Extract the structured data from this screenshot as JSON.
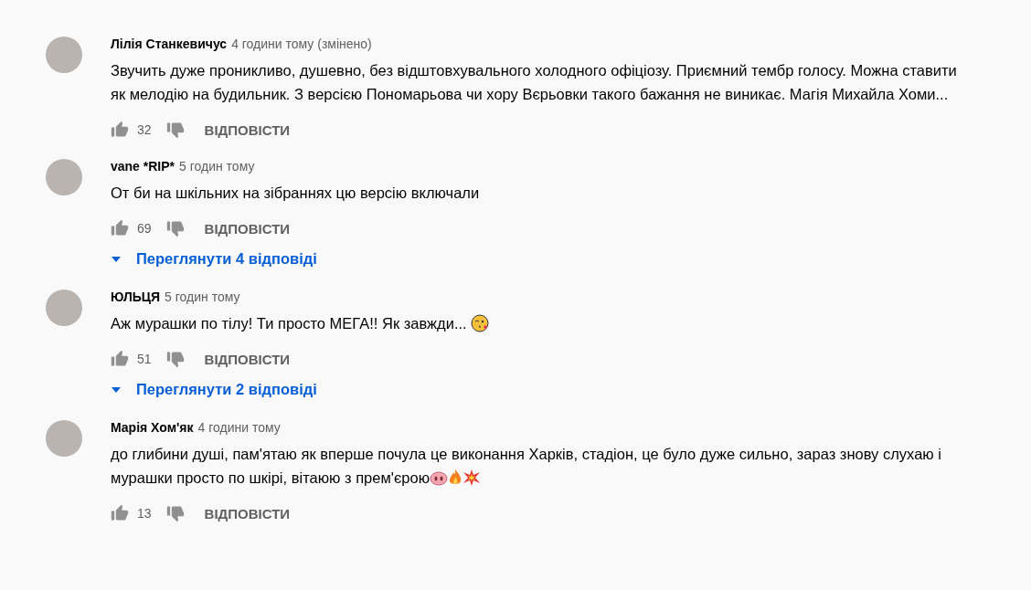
{
  "comments": [
    {
      "author": "Лілія Станкевичус",
      "time": "4 години тому (змінено)",
      "text": "Звучить дуже проникливо, душевно, без відштовхувального холодного офіціозу. Приємний тембр голосу. Можна ставити як мелодію на будильник. З версією Пономарьова чи хору Вєрьовки такого бажання не виникає. Магія Михайла Хоми...",
      "likes": "32",
      "reply": "ВІДПОВІСТИ"
    },
    {
      "author": "vane *RIP*",
      "time": "5 годин тому",
      "text": "От би на шкільних на зібраннях цю версію включали",
      "likes": "69",
      "reply": "ВІДПОВІСТИ",
      "replies": "Переглянути 4 відповіді"
    },
    {
      "author": "ЮЛЬЦЯ",
      "time": "5 годин тому",
      "text": "Аж мурашки по тілу! Ти просто МЕГА!! Як завжди... ",
      "emojis": [
        {
          "kind": "kiss"
        }
      ],
      "likes": "51",
      "reply": "ВІДПОВІСТИ",
      "replies": "Переглянути 2 відповіді"
    },
    {
      "author": "Марія Хом'як",
      "time": "4 години тому",
      "text": "до глибини душі, пам'ятаю як вперше почула це виконання Харків, стадіон, це було дуже сильно, зараз знову слухаю і мурашки просто по шкірі, вітаюю з прем'єрою",
      "emojis": [
        {
          "kind": "pig"
        },
        {
          "kind": "fire"
        },
        {
          "kind": "boom"
        }
      ],
      "likes": "13",
      "reply": "ВІДПОВІСТИ"
    }
  ]
}
